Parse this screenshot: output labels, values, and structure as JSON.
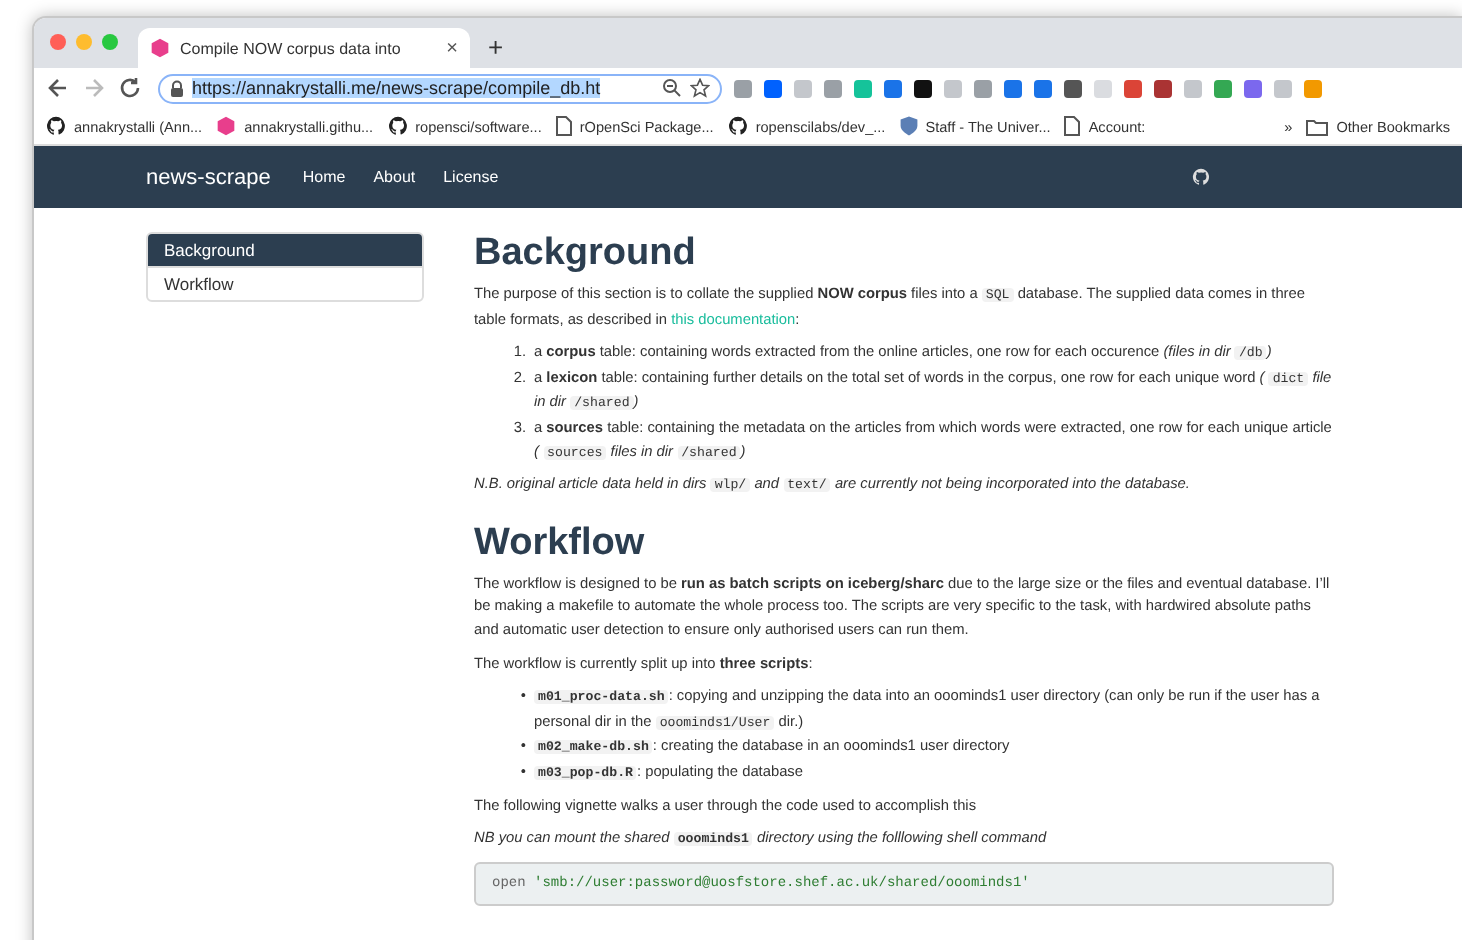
{
  "browser": {
    "tab_title": "Compile NOW corpus data into",
    "close": "×",
    "new_tab": "+",
    "url": "https://annakrystalli.me/news-scrape/compile_db.ht",
    "extensions": [
      {
        "color": "#9aa0a6"
      },
      {
        "color": "#0061fe"
      },
      {
        "color": "#c4c7cc"
      },
      {
        "color": "#9aa0a6"
      },
      {
        "color": "#15c39a"
      },
      {
        "color": "#1a73e8"
      },
      {
        "color": "#111111"
      },
      {
        "color": "#c4c7cc"
      },
      {
        "color": "#9aa0a6"
      },
      {
        "color": "#1a73e8"
      },
      {
        "color": "#1a73e8"
      },
      {
        "color": "#555555"
      },
      {
        "color": "#dadce0"
      },
      {
        "color": "#db4437"
      },
      {
        "color": "#a33"
      },
      {
        "color": "#c4c7cc"
      },
      {
        "color": "#34a853"
      },
      {
        "color": "#7b68ee"
      },
      {
        "color": "#c4c7cc"
      },
      {
        "color": "#f29900"
      }
    ],
    "bookmarks": [
      {
        "kind": "github",
        "label": "annakrystalli (Ann..."
      },
      {
        "kind": "hex",
        "label": "annakrystalli.githu..."
      },
      {
        "kind": "github",
        "label": "ropensci/software..."
      },
      {
        "kind": "page",
        "label": "rOpenSci Package..."
      },
      {
        "kind": "github",
        "label": "ropenscilabs/dev_..."
      },
      {
        "kind": "shield",
        "label": "Staff - The Univer..."
      },
      {
        "kind": "page",
        "label": "Account:"
      }
    ],
    "overflow": "»",
    "other_bookmarks": "Other Bookmarks"
  },
  "navbar": {
    "brand": "news-scrape",
    "links": [
      "Home",
      "About",
      "License"
    ]
  },
  "toc": [
    {
      "label": "Background",
      "selected": true
    },
    {
      "label": "Workflow",
      "selected": false
    }
  ],
  "sections": [
    {
      "heading": "Background",
      "blocks": [
        {
          "kind": "paragraph",
          "italic": false,
          "parts": [
            {
              "kind": "text",
              "text": "The purpose of this section is to collate the supplied **NOW corpus** files into a "
            },
            {
              "kind": "code",
              "text": "SQL"
            },
            {
              "kind": "text",
              "text": " database. The supplied data comes in three table formats, as described in "
            },
            {
              "kind": "link",
              "text": "this documentation"
            },
            {
              "kind": "text",
              "text": ":"
            }
          ]
        },
        {
          "kind": "list",
          "items": [
            {
              "marker": "1.",
              "parts": [
                {
                  "kind": "text",
                  "text": "a **corpus** table: containing words extracted from the online articles, one row for each occurence *(files in dir* "
                },
                {
                  "kind": "code",
                  "text": "/db"
                },
                {
                  "kind": "text",
                  "text": "*)*"
                }
              ]
            },
            {
              "marker": "2.",
              "parts": [
                {
                  "kind": "text",
                  "text": "a **lexicon** table: containing further details on the total set of words in the corpus, one row for each unique word *(* "
                },
                {
                  "kind": "code",
                  "text": "dict"
                },
                {
                  "kind": "text",
                  "text": " *file in dir* "
                },
                {
                  "kind": "code",
                  "text": "/shared"
                },
                {
                  "kind": "text",
                  "text": "*)*"
                }
              ]
            },
            {
              "marker": "3.",
              "parts": [
                {
                  "kind": "text",
                  "text": "a **sources** table: containing the metadata on the articles from which words were extracted, one row for each unique article *(* "
                },
                {
                  "kind": "code",
                  "text": "sources"
                },
                {
                  "kind": "text",
                  "text": " *files in dir* "
                },
                {
                  "kind": "code",
                  "text": "/shared"
                },
                {
                  "kind": "text",
                  "text": "*)*"
                }
              ]
            }
          ]
        },
        {
          "kind": "paragraph",
          "italic": true,
          "parts": [
            {
              "kind": "text",
              "text": "N.B. original article data held in dirs "
            },
            {
              "kind": "code",
              "text": "wlp/"
            },
            {
              "kind": "text",
              "text": " and "
            },
            {
              "kind": "code",
              "text": "text/"
            },
            {
              "kind": "text",
              "text": " are currently not being incorporated into the database."
            }
          ]
        }
      ]
    },
    {
      "heading": "Workflow",
      "blocks": [
        {
          "kind": "paragraph",
          "italic": false,
          "parts": [
            {
              "kind": "text",
              "text": "The workflow is designed to be **run as batch scripts on iceberg/sharc** due to the large size or the files and eventual database. I’ll be making a makefile to automate the whole process too. The scripts are very specific to the task, with hardwired absolute paths and automatic user detection to ensure only authorised users can run them."
            }
          ]
        },
        {
          "kind": "paragraph",
          "italic": false,
          "parts": [
            {
              "kind": "text",
              "text": "The workflow is currently split up into **three scripts**:"
            }
          ]
        },
        {
          "kind": "list",
          "items": [
            {
              "marker": "•",
              "parts": [
                {
                  "kind": "code",
                  "text": "**m01_proc-data.sh**"
                },
                {
                  "kind": "text",
                  "text": ": copying and unzipping the data into an ooominds1 user directory (can only be run if the user has a personal dir in the "
                },
                {
                  "kind": "code",
                  "text": "ooominds1/User"
                },
                {
                  "kind": "text",
                  "text": " dir.)"
                }
              ]
            },
            {
              "marker": "•",
              "parts": [
                {
                  "kind": "code",
                  "text": "**m02_make-db.sh**"
                },
                {
                  "kind": "text",
                  "text": ": creating the database in an ooominds1 user directory"
                }
              ]
            },
            {
              "marker": "•",
              "parts": [
                {
                  "kind": "code",
                  "text": "**m03_pop-db.R**"
                },
                {
                  "kind": "text",
                  "text": ": populating the database"
                }
              ]
            }
          ]
        },
        {
          "kind": "paragraph",
          "italic": false,
          "parts": [
            {
              "kind": "text",
              "text": "The following vignette walks a user through the code used to accomplish this"
            }
          ]
        },
        {
          "kind": "paragraph",
          "italic": true,
          "parts": [
            {
              "kind": "text",
              "text": "NB you can mount the shared "
            },
            {
              "kind": "code",
              "text": "**ooominds1**"
            },
            {
              "kind": "text",
              "text": " directory using the folllowing shell command"
            }
          ]
        },
        {
          "kind": "code_block",
          "tokens": [
            {
              "kind": "plain",
              "text": "open "
            },
            {
              "kind": "string",
              "text": "'smb://user:password@uosfstore.shef.ac.uk/shared/ooominds1'"
            }
          ]
        }
      ]
    }
  ]
}
